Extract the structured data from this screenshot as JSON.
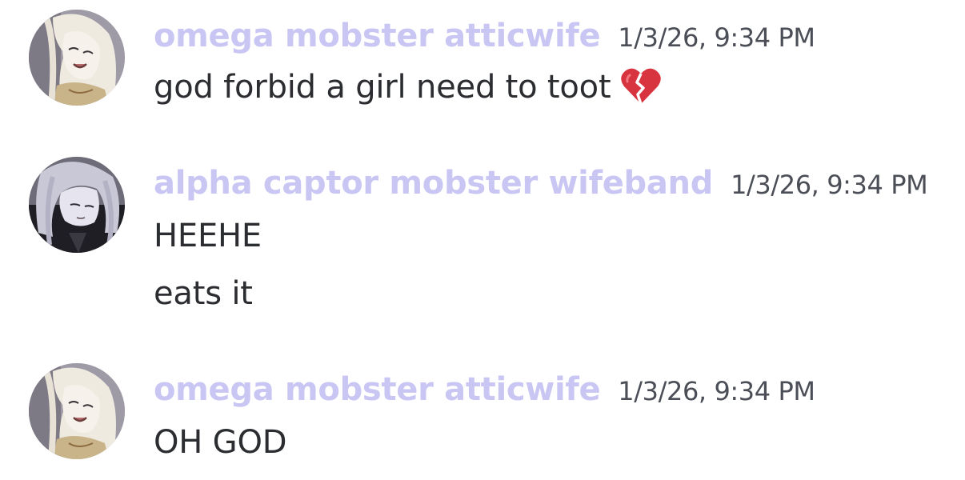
{
  "messages": [
    {
      "author": "omega mobster atticwife",
      "timestamp": "1/3/26, 9:34 PM",
      "avatar": "avatar-white-hair-laughing",
      "lines": [
        "god forbid a girl need to toot"
      ],
      "emoji": "broken-heart-icon"
    },
    {
      "author": "alpha captor mobster wifeband",
      "timestamp": "1/3/26, 9:34 PM",
      "avatar": "avatar-silver-hair-dark",
      "lines": [
        "HEEHE",
        "eats it"
      ]
    },
    {
      "author": "omega mobster atticwife",
      "timestamp": "1/3/26, 9:34 PM",
      "avatar": "avatar-white-hair-laughing",
      "lines": [
        "OH GOD"
      ]
    }
  ],
  "colors": {
    "username": "#c9c6f3",
    "timestamp": "#4b4e57",
    "message_text": "#2b2d31",
    "emoji": "#d8343f"
  }
}
